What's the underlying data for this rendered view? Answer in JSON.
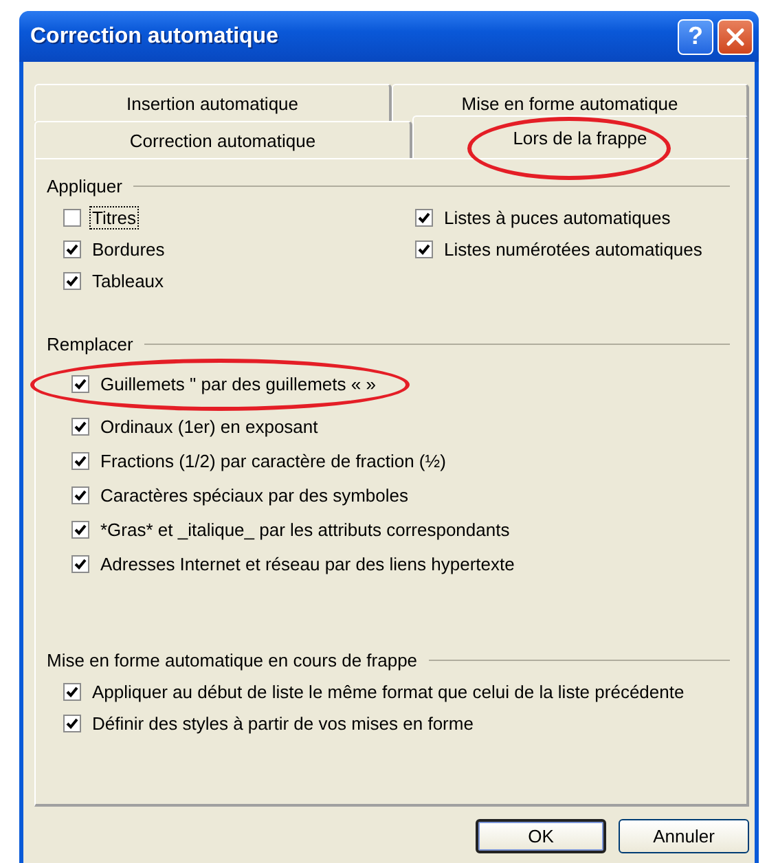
{
  "window": {
    "title": "Correction automatique",
    "help": "?"
  },
  "tab_rows": [
    {
      "tabs": [
        {
          "label": "Insertion automatique",
          "selected": false,
          "circled": false
        },
        {
          "label": "Mise en forme automatique",
          "selected": false,
          "circled": false
        }
      ]
    },
    {
      "tabs": [
        {
          "label": "Correction automatique",
          "selected": false,
          "circled": false
        },
        {
          "label": "Lors de la frappe",
          "selected": true,
          "circled": true
        }
      ]
    }
  ],
  "sections": [
    {
      "title": "Appliquer",
      "columns": [
        [
          {
            "label": "Titres",
            "checked": false,
            "focused": true,
            "circled": false
          },
          {
            "label": "Bordures",
            "checked": true,
            "focused": false,
            "circled": false
          },
          {
            "label": "Tableaux",
            "checked": true,
            "focused": false,
            "circled": false
          }
        ],
        [
          {
            "label": "Listes à puces automatiques",
            "checked": true,
            "focused": false,
            "circled": false
          },
          {
            "label": "Listes numérotées automatiques",
            "checked": true,
            "focused": false,
            "circled": false
          }
        ]
      ]
    },
    {
      "title": "Remplacer",
      "columns": [
        [
          {
            "label": "Guillemets \" par des guillemets « »",
            "checked": true,
            "focused": false,
            "circled": true
          },
          {
            "label": "Ordinaux (1er) en exposant",
            "checked": true,
            "focused": false,
            "circled": false
          },
          {
            "label": "Fractions (1/2) par caractère de fraction (½)",
            "checked": true,
            "focused": false,
            "circled": false
          },
          {
            "label": "Caractères spéciaux par des symboles",
            "checked": true,
            "focused": false,
            "circled": false
          },
          {
            "label": "*Gras* et _italique_ par les attributs correspondants",
            "checked": true,
            "focused": false,
            "circled": false
          },
          {
            "label": "Adresses Internet et réseau par des liens hypertexte",
            "checked": true,
            "focused": false,
            "circled": false
          }
        ]
      ]
    },
    {
      "title": "Mise en forme automatique en cours de frappe",
      "columns": [
        [
          {
            "label": "Appliquer au début de liste le même format que celui de la liste précédente",
            "checked": true,
            "focused": false,
            "circled": false
          },
          {
            "label": "Définir des styles à partir de vos mises en forme",
            "checked": true,
            "focused": false,
            "circled": false
          }
        ]
      ]
    }
  ],
  "buttons": [
    {
      "label": "OK",
      "default": true
    },
    {
      "label": "Annuler",
      "default": false
    }
  ]
}
